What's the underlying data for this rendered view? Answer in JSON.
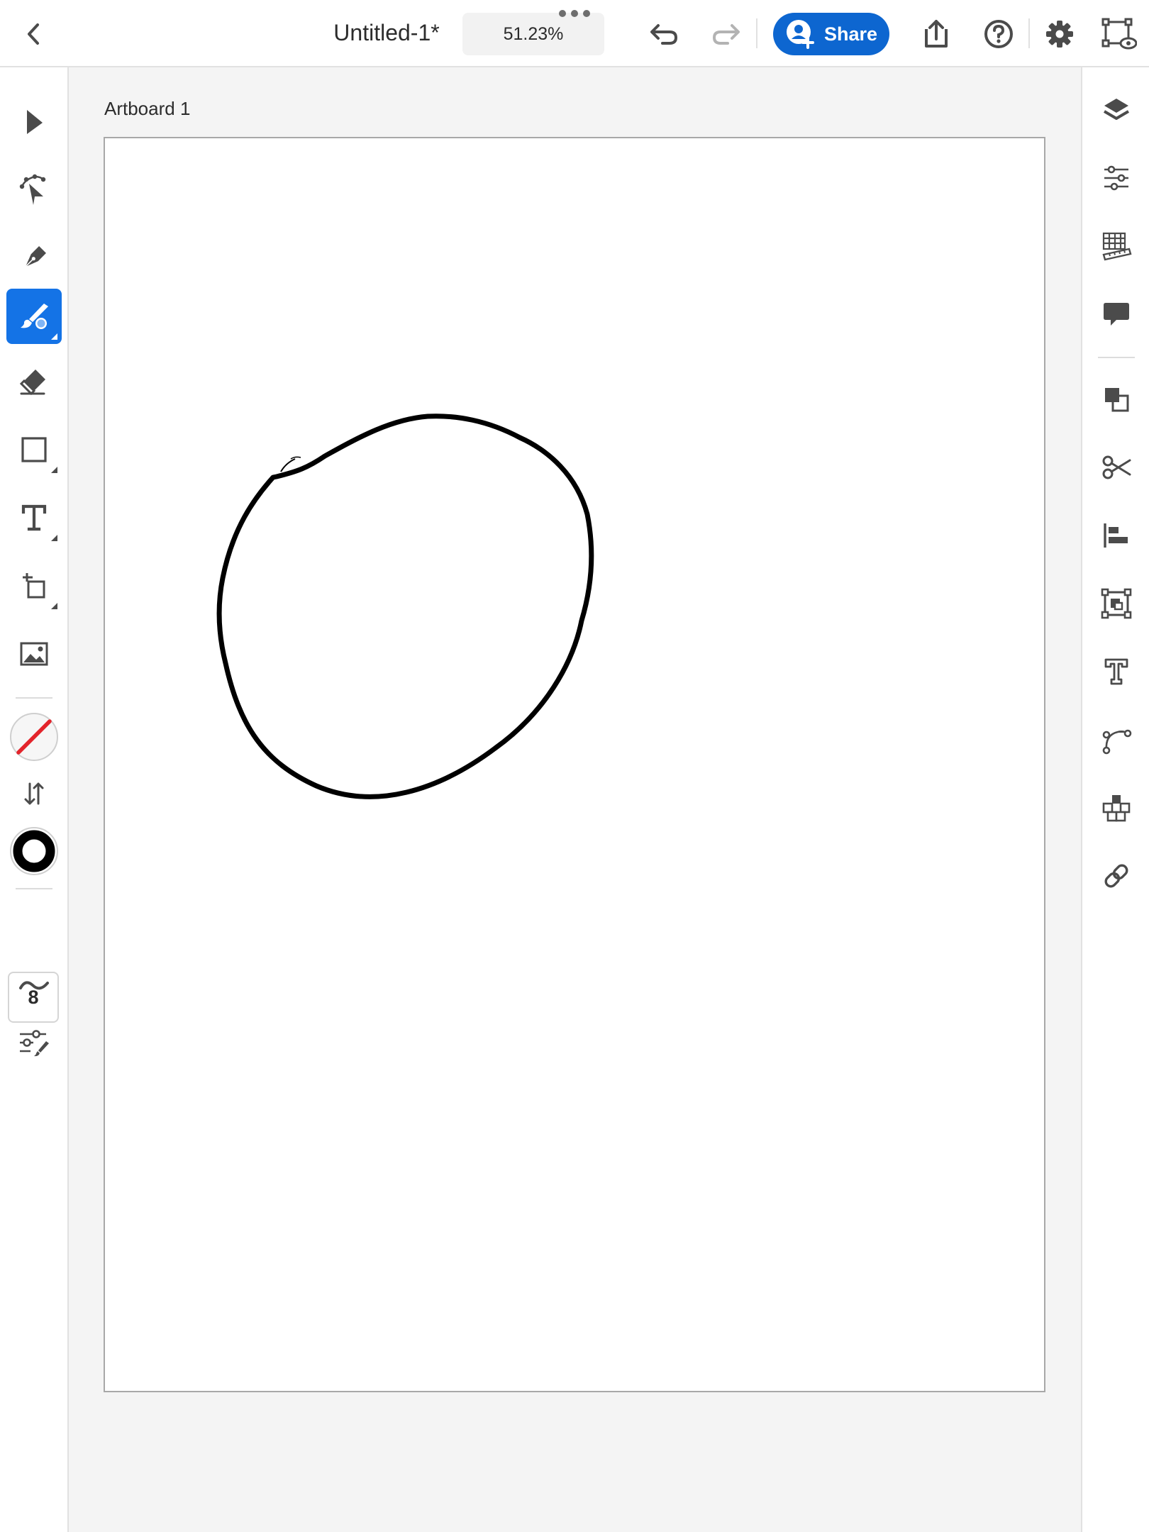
{
  "document": {
    "title": "Untitled-1*",
    "zoom": "51.23%"
  },
  "toolbar": {
    "share_label": "Share"
  },
  "left_tools": {
    "active_tool": "brush",
    "stroke_size": "8"
  },
  "canvas": {
    "artboard_name": "Artboard 1"
  },
  "colors": {
    "accent": "#1473e6",
    "share_button": "#0d66d0",
    "fill_none_slash": "#e3242b",
    "stroke": "#000000",
    "canvas_background": "#f4f4f4"
  },
  "icons": {
    "top": [
      "back-icon",
      "more-icon",
      "undo-icon",
      "redo-icon",
      "invite-user-icon",
      "export-icon",
      "help-icon",
      "settings-icon",
      "preview-icon"
    ],
    "left": [
      "selection-icon",
      "direct-selection-icon",
      "pen-icon",
      "brush-icon",
      "eraser-icon",
      "rectangle-icon",
      "type-icon",
      "transform-icon",
      "place-image-icon",
      "fill-none-icon",
      "swap-fill-stroke-icon",
      "stroke-color-icon",
      "smoothing-icon",
      "brush-settings-icon"
    ],
    "right": [
      "layers-icon",
      "properties-icon",
      "grid-icon",
      "comments-icon",
      "arrange-icon",
      "cut-icon",
      "align-icon",
      "crop-image-icon",
      "text-properties-icon",
      "path-icon",
      "repeat-icon",
      "link-icon"
    ]
  }
}
